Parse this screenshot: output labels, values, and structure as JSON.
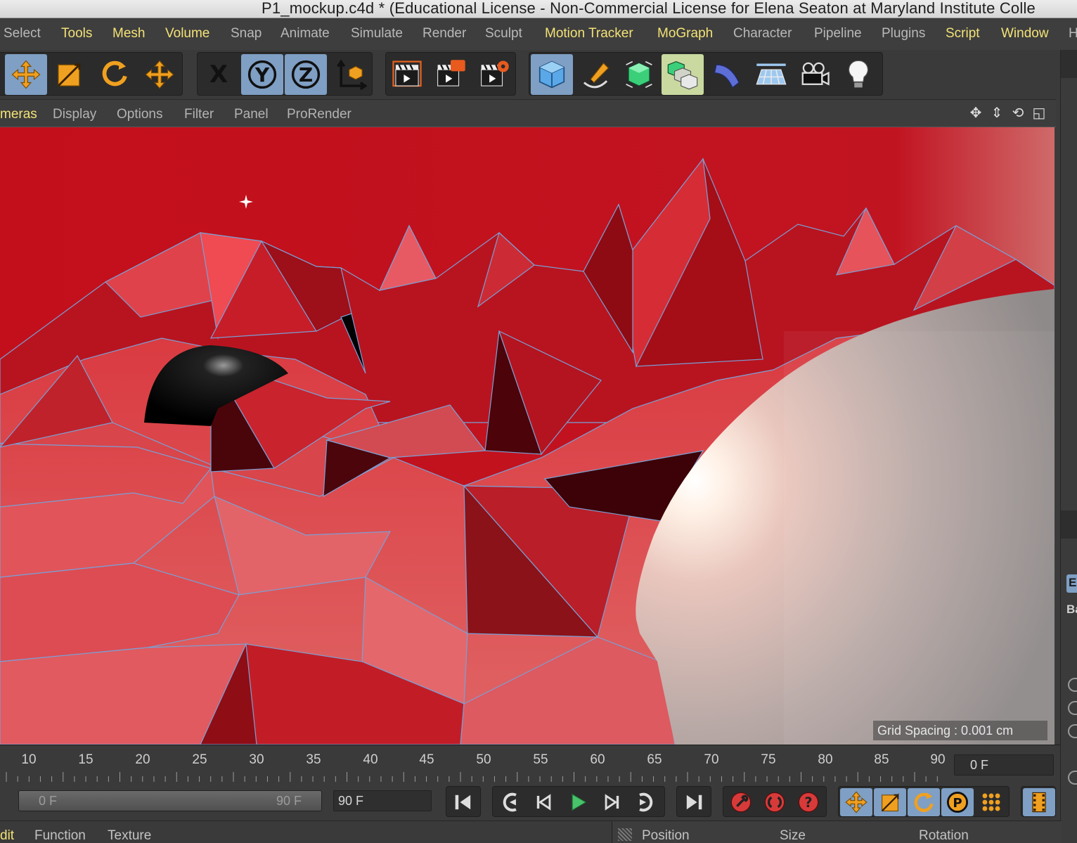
{
  "window": {
    "title": "P1_mockup.c4d * (Educational License - Non-Commercial License for Elena Seaton at Maryland Institute Colle"
  },
  "menubar": {
    "items": [
      {
        "label": "Select",
        "highlight": false
      },
      {
        "label": "Tools",
        "highlight": true
      },
      {
        "label": "Mesh",
        "highlight": true
      },
      {
        "label": "Volume",
        "highlight": true
      },
      {
        "label": "Snap",
        "highlight": false
      },
      {
        "label": "Animate",
        "highlight": false
      },
      {
        "label": "Simulate",
        "highlight": false
      },
      {
        "label": "Render",
        "highlight": false
      },
      {
        "label": "Sculpt",
        "highlight": false
      },
      {
        "label": "Motion Tracker",
        "highlight": true
      },
      {
        "label": "MoGraph",
        "highlight": true
      },
      {
        "label": "Character",
        "highlight": false
      },
      {
        "label": "Pipeline",
        "highlight": false
      },
      {
        "label": "Plugins",
        "highlight": false
      },
      {
        "label": "Script",
        "highlight": true
      },
      {
        "label": "Window",
        "highlight": true
      },
      {
        "label": "H",
        "highlight": false
      }
    ]
  },
  "toolbar": {
    "axis_x": "X",
    "axis_y": "Y",
    "axis_z": "Z",
    "accent_orange": "#f0a020",
    "active_blue": "#7f9fc4"
  },
  "viewport_menu": {
    "items": [
      "meras",
      "Display",
      "Options",
      "Filter",
      "Panel",
      "ProRender"
    ]
  },
  "viewport": {
    "grid_spacing": "Grid Spacing : 0.001 cm",
    "background_color": "#c40d19"
  },
  "right_panel": {
    "letter_e": "E",
    "label_ba": "Ba"
  },
  "timeline": {
    "ticks": [
      "10",
      "15",
      "20",
      "25",
      "30",
      "35",
      "40",
      "45",
      "50",
      "55",
      "60",
      "65",
      "70",
      "75",
      "80",
      "85",
      "90"
    ],
    "current_frame": "0 F"
  },
  "transport": {
    "range_start": "0 F",
    "range_end": "90 F",
    "end_frame": "90 F"
  },
  "bottombar": {
    "items": [
      "dit",
      "Function",
      "Texture"
    ],
    "coord_headers": [
      "Position",
      "Size",
      "Rotation"
    ]
  }
}
